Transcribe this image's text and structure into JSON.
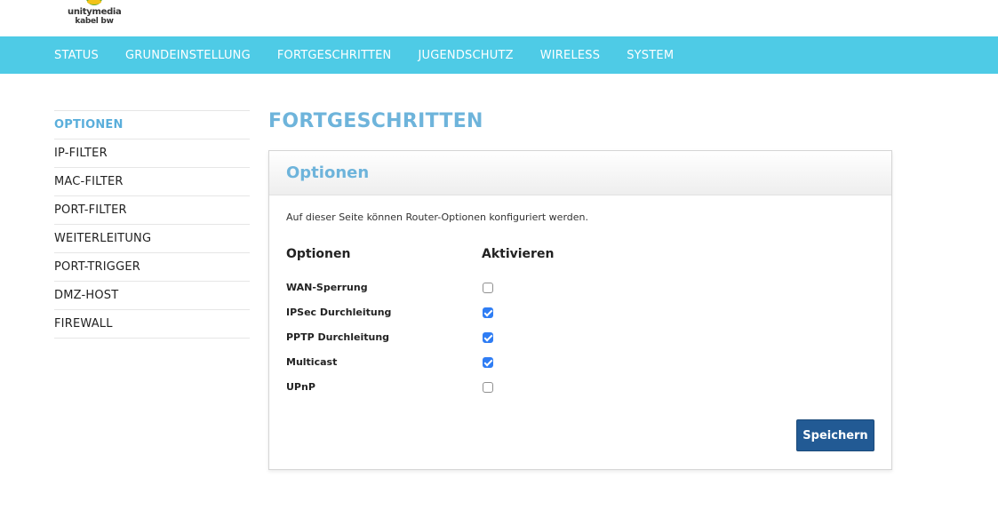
{
  "brand": {
    "line1": "unitymedia",
    "line2": "kabel bw"
  },
  "nav": {
    "items": [
      {
        "label": "STATUS"
      },
      {
        "label": "GRUNDEINSTELLUNG"
      },
      {
        "label": "FORTGESCHRITTEN"
      },
      {
        "label": "JUGENDSCHUTZ"
      },
      {
        "label": "WIRELESS"
      },
      {
        "label": "SYSTEM"
      }
    ]
  },
  "sidebar": {
    "items": [
      {
        "label": "OPTIONEN",
        "active": true
      },
      {
        "label": "IP-FILTER"
      },
      {
        "label": "MAC-FILTER"
      },
      {
        "label": "PORT-FILTER"
      },
      {
        "label": "WEITERLEITUNG"
      },
      {
        "label": "PORT-TRIGGER"
      },
      {
        "label": "DMZ-HOST"
      },
      {
        "label": "FIREWALL"
      }
    ]
  },
  "main": {
    "page_title": "FORTGESCHRITTEN",
    "panel": {
      "title": "Optionen",
      "description": "Auf dieser Seite können Router-Optionen konfiguriert werden.",
      "column_headers": {
        "option": "Optionen",
        "enable": "Aktivieren"
      },
      "options": [
        {
          "label": "WAN-Sperrung",
          "checked": false
        },
        {
          "label": "IPSec Durchleitung",
          "checked": true
        },
        {
          "label": "PPTP Durchleitung",
          "checked": true
        },
        {
          "label": "Multicast",
          "checked": true
        },
        {
          "label": "UPnP",
          "checked": false
        }
      ],
      "save_label": "Speichern"
    }
  },
  "colors": {
    "nav_background": "#4ecbe6",
    "accent_title": "#6eb4db",
    "sidebar_active": "#5aaedb",
    "button_background": "#225a94",
    "checkbox_checked": "#2f7df4"
  },
  "icons": {
    "logo": "unitymedia-logo-icon",
    "checkbox_checked": "checkmark-icon"
  }
}
